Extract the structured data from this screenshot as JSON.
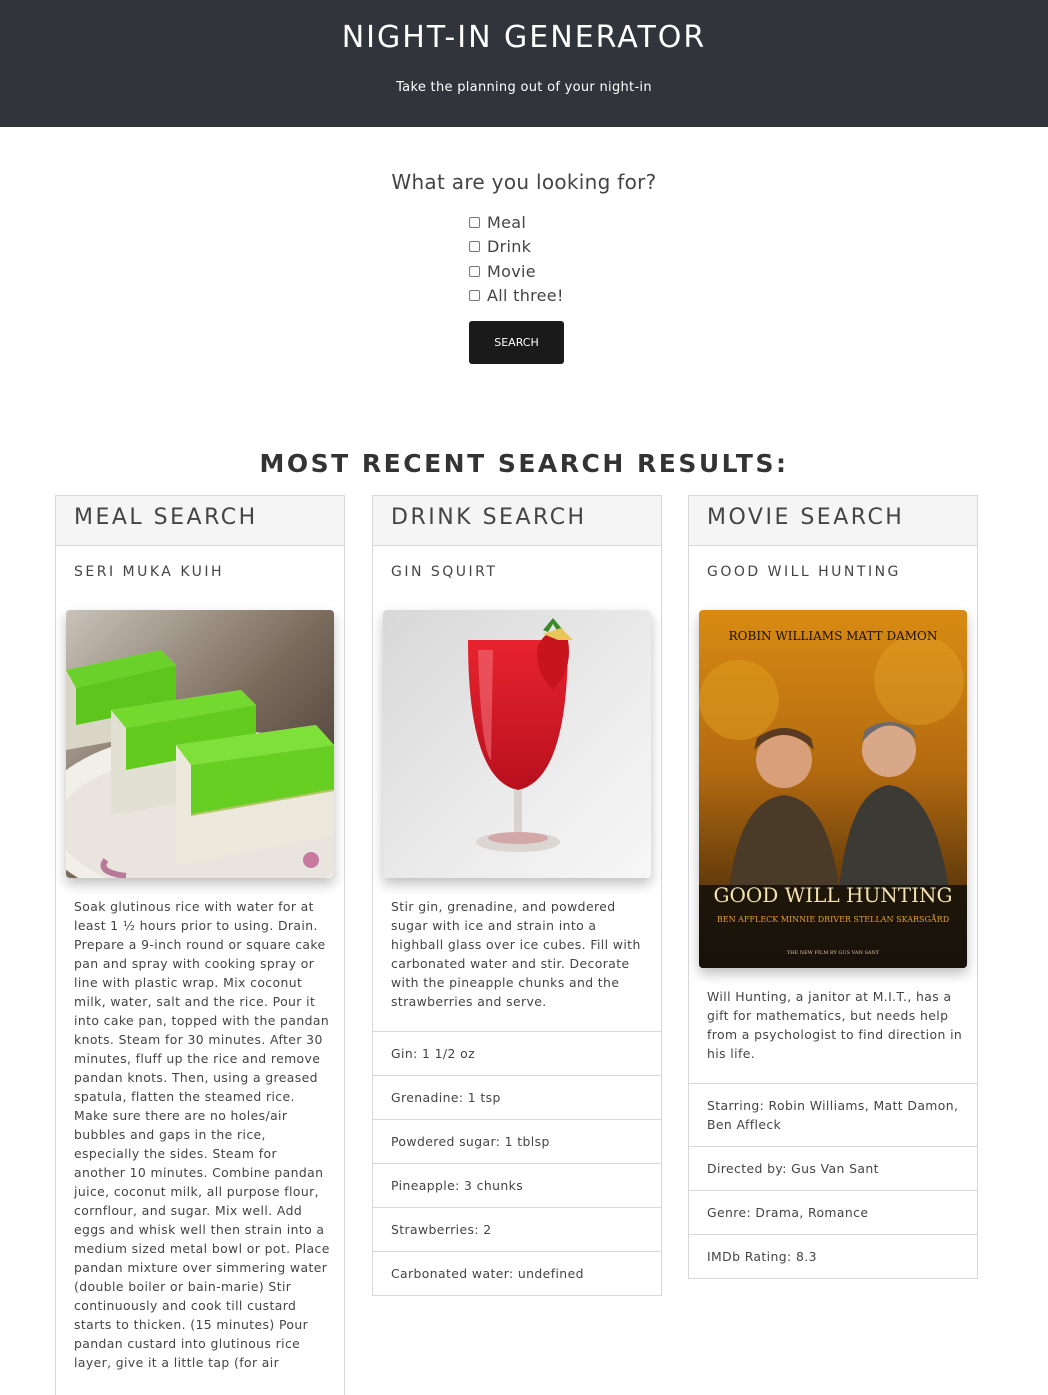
{
  "header": {
    "title": "NIGHT-IN GENERATOR",
    "subtitle": "Take the planning out of your night-in"
  },
  "form": {
    "question": "What are you looking for?",
    "options": [
      "Meal",
      "Drink",
      "Movie",
      "All three!"
    ],
    "search_label": "SEARCH"
  },
  "results": {
    "heading": "MOST RECENT SEARCH RESULTS:",
    "meal": {
      "header": "MEAL SEARCH",
      "title": "SERI MUKA KUIH",
      "image_icon": "kuih-image",
      "description": "Soak glutinous rice with water for at least 1 ½ hours prior to using. Drain. Prepare a 9-inch round or square cake pan and spray with cooking spray or line with plastic wrap. Mix coconut milk, water, salt and the rice. Pour it into cake pan, topped with the pandan knots. Steam for 30 minutes. After 30 minutes, fluff up the rice and remove pandan knots. Then, using a greased spatula, flatten the steamed rice. Make sure there are no holes/air bubbles and gaps in the rice, especially the sides. Steam for another 10 minutes. Combine pandan juice, coconut milk, all purpose flour, cornflour, and sugar. Mix well. Add eggs and whisk well then strain into a medium sized metal bowl or pot. Place pandan mixture over simmering water (double boiler or bain-marie) Stir continuously and cook till custard starts to thicken. (15 minutes) Pour pandan custard into glutinous rice layer, give it a little tap (for air"
    },
    "drink": {
      "header": "DRINK SEARCH",
      "title": "GIN SQUIRT",
      "image_icon": "cocktail-image",
      "description": "Stir gin, grenadine, and powdered sugar with ice and strain into a highball glass over ice cubes. Fill with carbonated water and stir. Decorate with the pineapple chunks and the strawberries and serve.",
      "ingredients": [
        "Gin: 1 1/2 oz",
        "Grenadine: 1 tsp",
        "Powdered sugar: 1 tblsp",
        "Pineapple: 3 chunks",
        "Strawberries: 2",
        "Carbonated water: undefined"
      ]
    },
    "movie": {
      "header": "MOVIE SEARCH",
      "title": "GOOD WILL HUNTING",
      "image_icon": "movie-poster-image",
      "poster": {
        "actors_top": "ROBIN WILLIAMS   MATT DAMON",
        "poster_title": "GOOD WILL HUNTING",
        "actors_bottom": "BEN AFFLECK   MINNIE DRIVER   STELLAN SKARSGÅRD",
        "footer": "THE NEW FILM BY GUS VAN SANT"
      },
      "description": "Will Hunting, a janitor at M.I.T., has a gift for mathematics, but needs help from a psychologist to find direction in his life.",
      "details": [
        "Starring: Robin Williams, Matt Damon, Ben Affleck",
        "Directed by: Gus Van Sant",
        "Genre: Drama, Romance",
        "IMDb Rating: 8.3"
      ]
    }
  },
  "colors": {
    "header_bg": "#31343a",
    "button_bg": "#1a1a1a",
    "card_header_bg": "#f5f5f5",
    "border": "#d8d8d8"
  }
}
